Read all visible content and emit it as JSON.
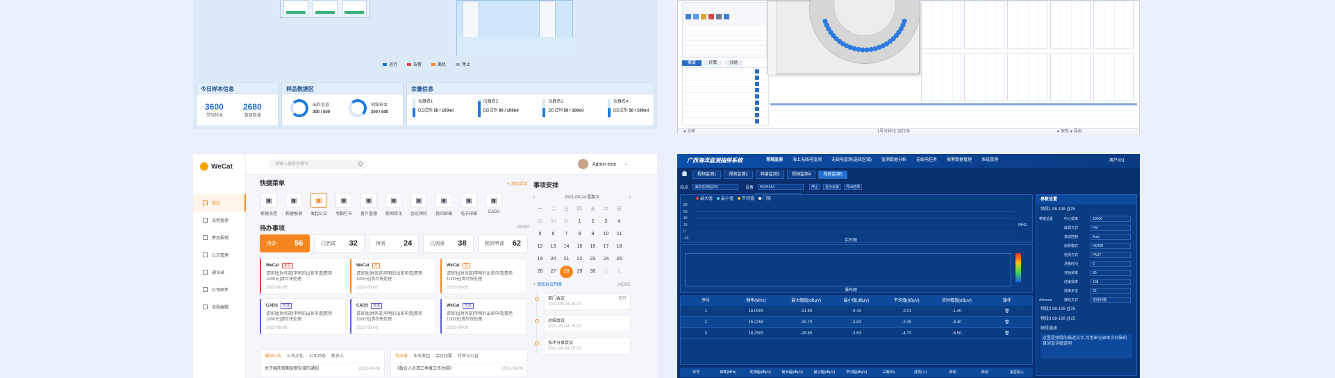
{
  "top_left": {
    "legend": [
      "运行",
      "告警",
      "离机",
      "停止"
    ],
    "legend_colors": [
      "#1f6fd1",
      "#e64545",
      "#f08a24",
      "#9aa5b1"
    ],
    "today": {
      "title": "今日样本信息",
      "v1": "3600",
      "l1": "受验样本",
      "v2": "2680",
      "l2": "数目数量"
    },
    "samples": {
      "title": "样品数据区",
      "a_label": "出料信息",
      "a_val": "300 / 500",
      "b_label": "销毁样本",
      "b_val": "300 / 500"
    },
    "remain": {
      "title": "余量信息",
      "items": [
        {
          "name": "仪器名1",
          "val": "50 / 100ml",
          "unit": "DD试剂"
        },
        {
          "name": "仪器名2",
          "val": "90 / 100ml",
          "unit": "DD试剂"
        },
        {
          "name": "仪器名1",
          "val": "50 / 100ml",
          "unit": "DD试剂"
        },
        {
          "name": "仪器名4",
          "val": "50 / 100ml",
          "unit": "DD试剂"
        }
      ]
    }
  },
  "top_right": {
    "tabs": [
      "概要",
      "详情",
      "分组"
    ],
    "status": "1号分析仪 运行中",
    "footer_left": "● 分析",
    "footer_right": "● 保存 ● 导出"
  },
  "wecat": {
    "logo": "WeCat",
    "search_placeholder": "请输入搜索关键词",
    "user": "Admin-tree",
    "nav": [
      "首页",
      "流程管理",
      "费用报销",
      "公文管理",
      "通讯录",
      "公司邮件",
      "流程编辑"
    ],
    "quick_title": "快捷菜单",
    "quick_add": "+ 添加菜单",
    "quick": [
      "新建流程",
      "新建报销",
      "发起公文",
      "考勤打卡",
      "客户管理",
      "新闻资讯",
      "会议预约",
      "我的邮箱",
      "电子印章",
      "CADS"
    ],
    "todo_title": "待办事项",
    "more": "MORE",
    "todo_tabs": [
      {
        "label": "待办",
        "n": "56"
      },
      {
        "label": "已完成",
        "n": "32"
      },
      {
        "label": "待阅",
        "n": "24"
      },
      {
        "label": "已阅读",
        "n": "38"
      },
      {
        "label": "我的申请",
        "n": "62"
      }
    ],
    "cards": [
      {
        "title": "WeCat",
        "tag": "紧急",
        "text": "请审批[财务部]李明的出差申请[费用1000元]请尽快处理",
        "date": "2022-08-06"
      },
      {
        "title": "WeCat",
        "tag": "急",
        "text": "请审批[财务部]李明的出差申请[费用1000元]请尽快处理",
        "date": "2022-08-06"
      },
      {
        "title": "WeCat",
        "tag": "急",
        "text": "请审批[财务部]李明的出差申请[费用1000元]请尽快处理",
        "date": "2022-08-06"
      },
      {
        "title": "CADS",
        "tag": "普通",
        "text": "请审批[财务部]李明的出差申请[费用1000元]请尽快处理",
        "date": "2022-08-06"
      },
      {
        "title": "CADS",
        "tag": "普通",
        "text": "请审批[财务部]李明的出差申请[费用1000元]请尽快处理",
        "date": "2022-08-06"
      },
      {
        "title": "WeCat",
        "tag": "普通",
        "text": "请审批[财务部]李明的出差申请[费用1000元]请尽快处理",
        "date": "2022-08-06"
      }
    ],
    "notice_tabs": [
      "通知公告",
      "公司文化",
      "公司动态",
      "新员工"
    ],
    "notice_item": "关于国庆假期放假安排的通知",
    "notice_date": "2022-08-06",
    "task_tabs": [
      "待办事",
      "业务发起",
      "会议纪要",
      "待审与公益"
    ],
    "task_item": "《政企人员请三季度工作总结》",
    "task_date": "2022-08-06",
    "events_title": "事项安排",
    "cal_header": "2021-09-24  星期五",
    "weekdays": [
      "一",
      "二",
      "三",
      "四",
      "五",
      "六",
      "日"
    ],
    "cal": [
      "29",
      "30",
      "31",
      "1",
      "2",
      "3",
      "4",
      "5",
      "6",
      "7",
      "8",
      "9",
      "10",
      "11",
      "12",
      "13",
      "14",
      "15",
      "16",
      "17",
      "18",
      "19",
      "20",
      "21",
      "22",
      "23",
      "24",
      "25",
      "26",
      "27",
      "28",
      "29",
      "30",
      "1",
      "2"
    ],
    "add_meeting": "+ 添加会议列表",
    "timeline": [
      {
        "t": "部门会议",
        "d": "2021-09-24 15:20",
        "s": "待开"
      },
      {
        "t": "总结会议",
        "d": "2021-09-24 15:20",
        "s": ""
      },
      {
        "t": "技术分享会议",
        "d": "2021-09-24 15:20",
        "s": ""
      }
    ]
  },
  "monitor": {
    "title": "广西海洋监测指挥系统",
    "nav": [
      "常规监测",
      "海上无线电监测",
      "无线电监测(选择区域)",
      "监测数据分析",
      "无线电任务",
      "报警数据管理",
      "系统管理"
    ],
    "user": "用户001",
    "tabs": [
      "视频监测1",
      "视频监测2",
      "频谱监测3",
      "视频监测4",
      "视频监测5"
    ],
    "toolbar": {
      "label1": "站点",
      "v1": "海华检测站(20)",
      "label2": "设备",
      "v2": "HX041A1",
      "btn1": "停止",
      "btn2": "显示设置",
      "btn3": "导出结果"
    },
    "dropdown": [
      "HX041A1",
      "HX041A2",
      "HX041A3"
    ],
    "legend": [
      "最大值",
      "最小值",
      "平均值",
      "门限"
    ],
    "yticks": [
      "80",
      "60",
      "40",
      "20",
      "0",
      "-20"
    ],
    "chart1_label": "实时图",
    "chart2_label": "瀑布图",
    "unit": "MHz",
    "table_head": [
      "序号",
      "频率(MHz)",
      "最大幅值(dBμV)",
      "最小值(dBμV)",
      "平均值(dBμV)",
      "实时幅值(dBμV)",
      "操作"
    ],
    "table_rows": [
      [
        "1",
        "18.0000",
        "-31.80",
        "-9.43",
        "-2.01",
        "-1.40"
      ],
      [
        "2",
        "15.2250",
        "-30.70",
        "-3.83",
        "-3.35",
        "-8.40"
      ],
      [
        "3",
        "18.2500",
        "-28.80",
        "-3.63",
        "-4.70",
        "-6.50"
      ]
    ],
    "table2_head": [
      "序号",
      "频率(MHz)",
      "实测幅(dBμV)",
      "最大幅(dBμV)",
      "最小幅(dBμV)",
      "平均幅(dBμV)",
      "占用(%)",
      "成员(人)",
      "启动",
      "启动",
      "是否加入"
    ],
    "side_title": "参数设置",
    "side_group1": "频段1 88-108 @25",
    "params": [
      [
        "带宽设置",
        "中心频率",
        "10000"
      ],
      [
        "",
        "解调方式",
        "FM"
      ],
      [
        "",
        "衰减控制",
        "Auto"
      ],
      [
        "",
        "射频模式",
        "NORM"
      ],
      [
        "",
        "检测方式",
        "FAST"
      ],
      [
        "",
        "测量时间",
        "0"
      ],
      [
        "",
        "开始频率",
        "80"
      ],
      [
        "",
        "结束频率",
        "108"
      ],
      [
        "",
        "频率步进",
        "25"
      ],
      [
        "Antenna",
        "接收方式",
        "定频扫描"
      ]
    ],
    "side_group2": "频段2 88-108 @25",
    "side_group3": "频段3 88-108 @25",
    "note_title": "频段描述",
    "note_text": "这里是频段的描述文字,可用来记录本次扫描的目的及详细说明"
  }
}
